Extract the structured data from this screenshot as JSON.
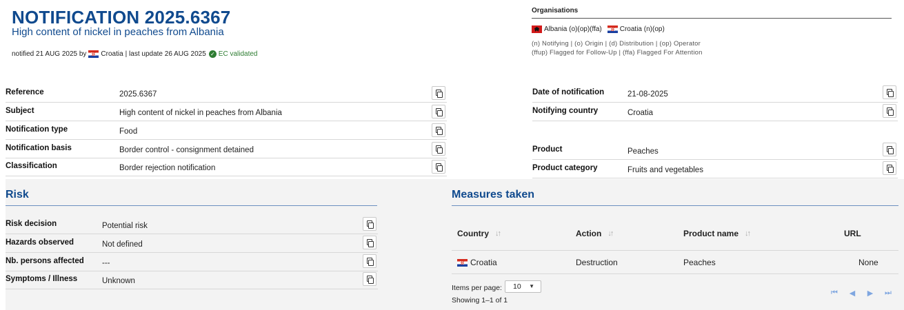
{
  "header": {
    "title": "NOTIFICATION 2025.6367",
    "subtitle": "High content of nickel in peaches from Albania",
    "notified_prefix": "notified 21 AUG 2025 by",
    "notified_country": "Croatia",
    "last_update": "| last update 26 AUG 2025",
    "validation": "EC validated"
  },
  "organisations": {
    "title": "Organisations",
    "items": [
      {
        "flag": "albania-flag",
        "label": "Albania (o)(op)(ffa)"
      },
      {
        "flag": "croatia-flag",
        "label": "Croatia (n)(op)"
      }
    ],
    "legend_line1": "(n) Notifying | (o) Origin | (d) Distribution | (op) Operator",
    "legend_line2": "(ffup) Flagged for Follow-Up | (ffa) Flagged For Attention"
  },
  "details_left": [
    {
      "label": "Reference",
      "value": "2025.6367"
    },
    {
      "label": "Subject",
      "value": "High content of nickel in peaches from Albania"
    },
    {
      "label": "Notification type",
      "value": "Food"
    },
    {
      "label": "Notification basis",
      "value": "Border control - consignment detained"
    },
    {
      "label": "Classification",
      "value": "Border rejection notification"
    }
  ],
  "details_right": [
    {
      "label": "Date of notification",
      "value": "21-08-2025"
    },
    {
      "label": "Notifying country",
      "value": "Croatia"
    },
    {
      "label": "Product",
      "value": "Peaches"
    },
    {
      "label": "Product category",
      "value": "Fruits and vegetables"
    }
  ],
  "risk": {
    "title": "Risk",
    "rows": [
      {
        "label": "Risk decision",
        "value": "Potential risk"
      },
      {
        "label": "Hazards observed",
        "value": "Not defined"
      },
      {
        "label": "Nb. persons affected",
        "value": "---"
      },
      {
        "label": "Symptoms / Illness",
        "value": "Unknown"
      }
    ]
  },
  "measures": {
    "title": "Measures taken",
    "columns": [
      "Country",
      "Action",
      "Product name",
      "URL"
    ],
    "rows": [
      {
        "country": "Croatia",
        "action": "Destruction",
        "product": "Peaches",
        "url": "None"
      }
    ],
    "items_per_page_label": "Items per page:",
    "items_per_page_value": "10",
    "showing": "Showing 1–1 of 1"
  },
  "icons": {
    "copy": "copy-icon",
    "sort": "sort-icon",
    "check": "check-circle-icon",
    "first": "first-page-icon",
    "prev": "prev-page-icon",
    "next": "next-page-icon",
    "last": "last-page-icon"
  },
  "colors": {
    "title_blue": "#104a8e",
    "validated_green": "#2e7d32",
    "pager_blue": "#7fa6e0"
  }
}
